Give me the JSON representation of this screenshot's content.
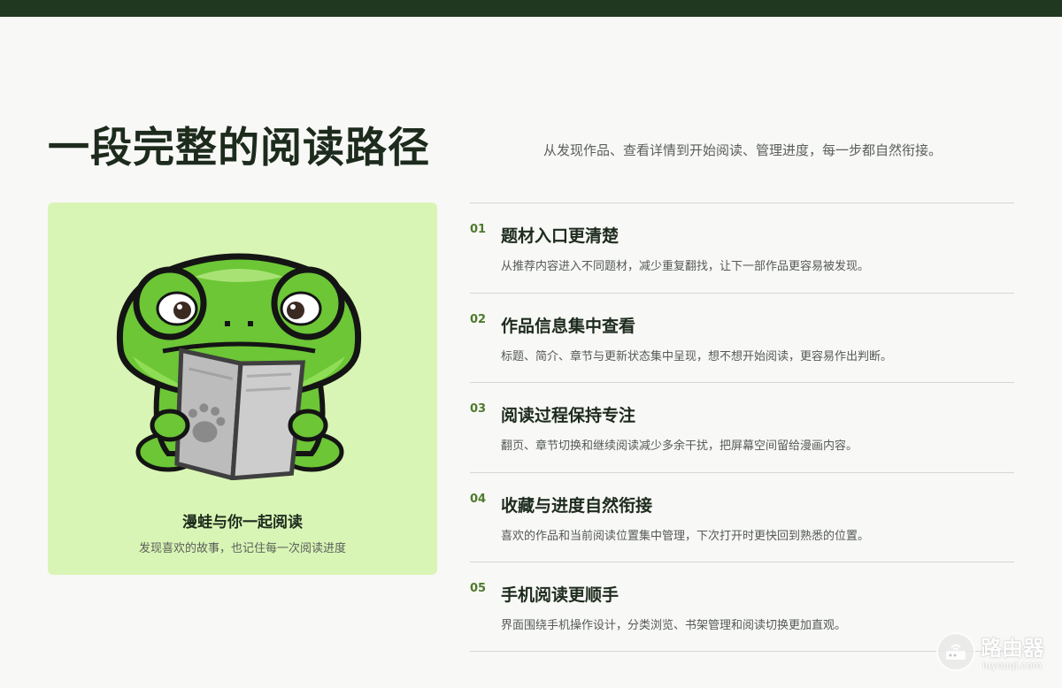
{
  "section": {
    "title": "一段完整的阅读路径",
    "subtitle": "从发现作品、查看详情到开始阅读、管理进度，每一步都自然衔接。"
  },
  "card": {
    "illustration": "pixel-frog-reading-book",
    "title": "漫蛙与你一起阅读",
    "subtitle": "发现喜欢的故事，也记住每一次阅读进度"
  },
  "features": [
    {
      "num": "01",
      "title": "题材入口更清楚",
      "desc": "从推荐内容进入不同题材，减少重复翻找，让下一部作品更容易被发现。"
    },
    {
      "num": "02",
      "title": "作品信息集中查看",
      "desc": "标题、简介、章节与更新状态集中呈现，想不想开始阅读，更容易作出判断。"
    },
    {
      "num": "03",
      "title": "阅读过程保持专注",
      "desc": "翻页、章节切换和继续阅读减少多余干扰，把屏幕空间留给漫画内容。"
    },
    {
      "num": "04",
      "title": "收藏与进度自然衔接",
      "desc": "喜欢的作品和当前阅读位置集中管理，下次打开时更快回到熟悉的位置。"
    },
    {
      "num": "05",
      "title": "手机阅读更顺手",
      "desc": "界面围绕手机操作设计，分类浏览、书架管理和阅读切换更加直观。"
    }
  ],
  "watermark": {
    "name": "路由器",
    "url": "luyouqi.com"
  },
  "colors": {
    "topbar": "#203820",
    "card_background": "#d9f5b5",
    "accent_number": "#4d7a2c",
    "heading": "#1d2b1d"
  }
}
